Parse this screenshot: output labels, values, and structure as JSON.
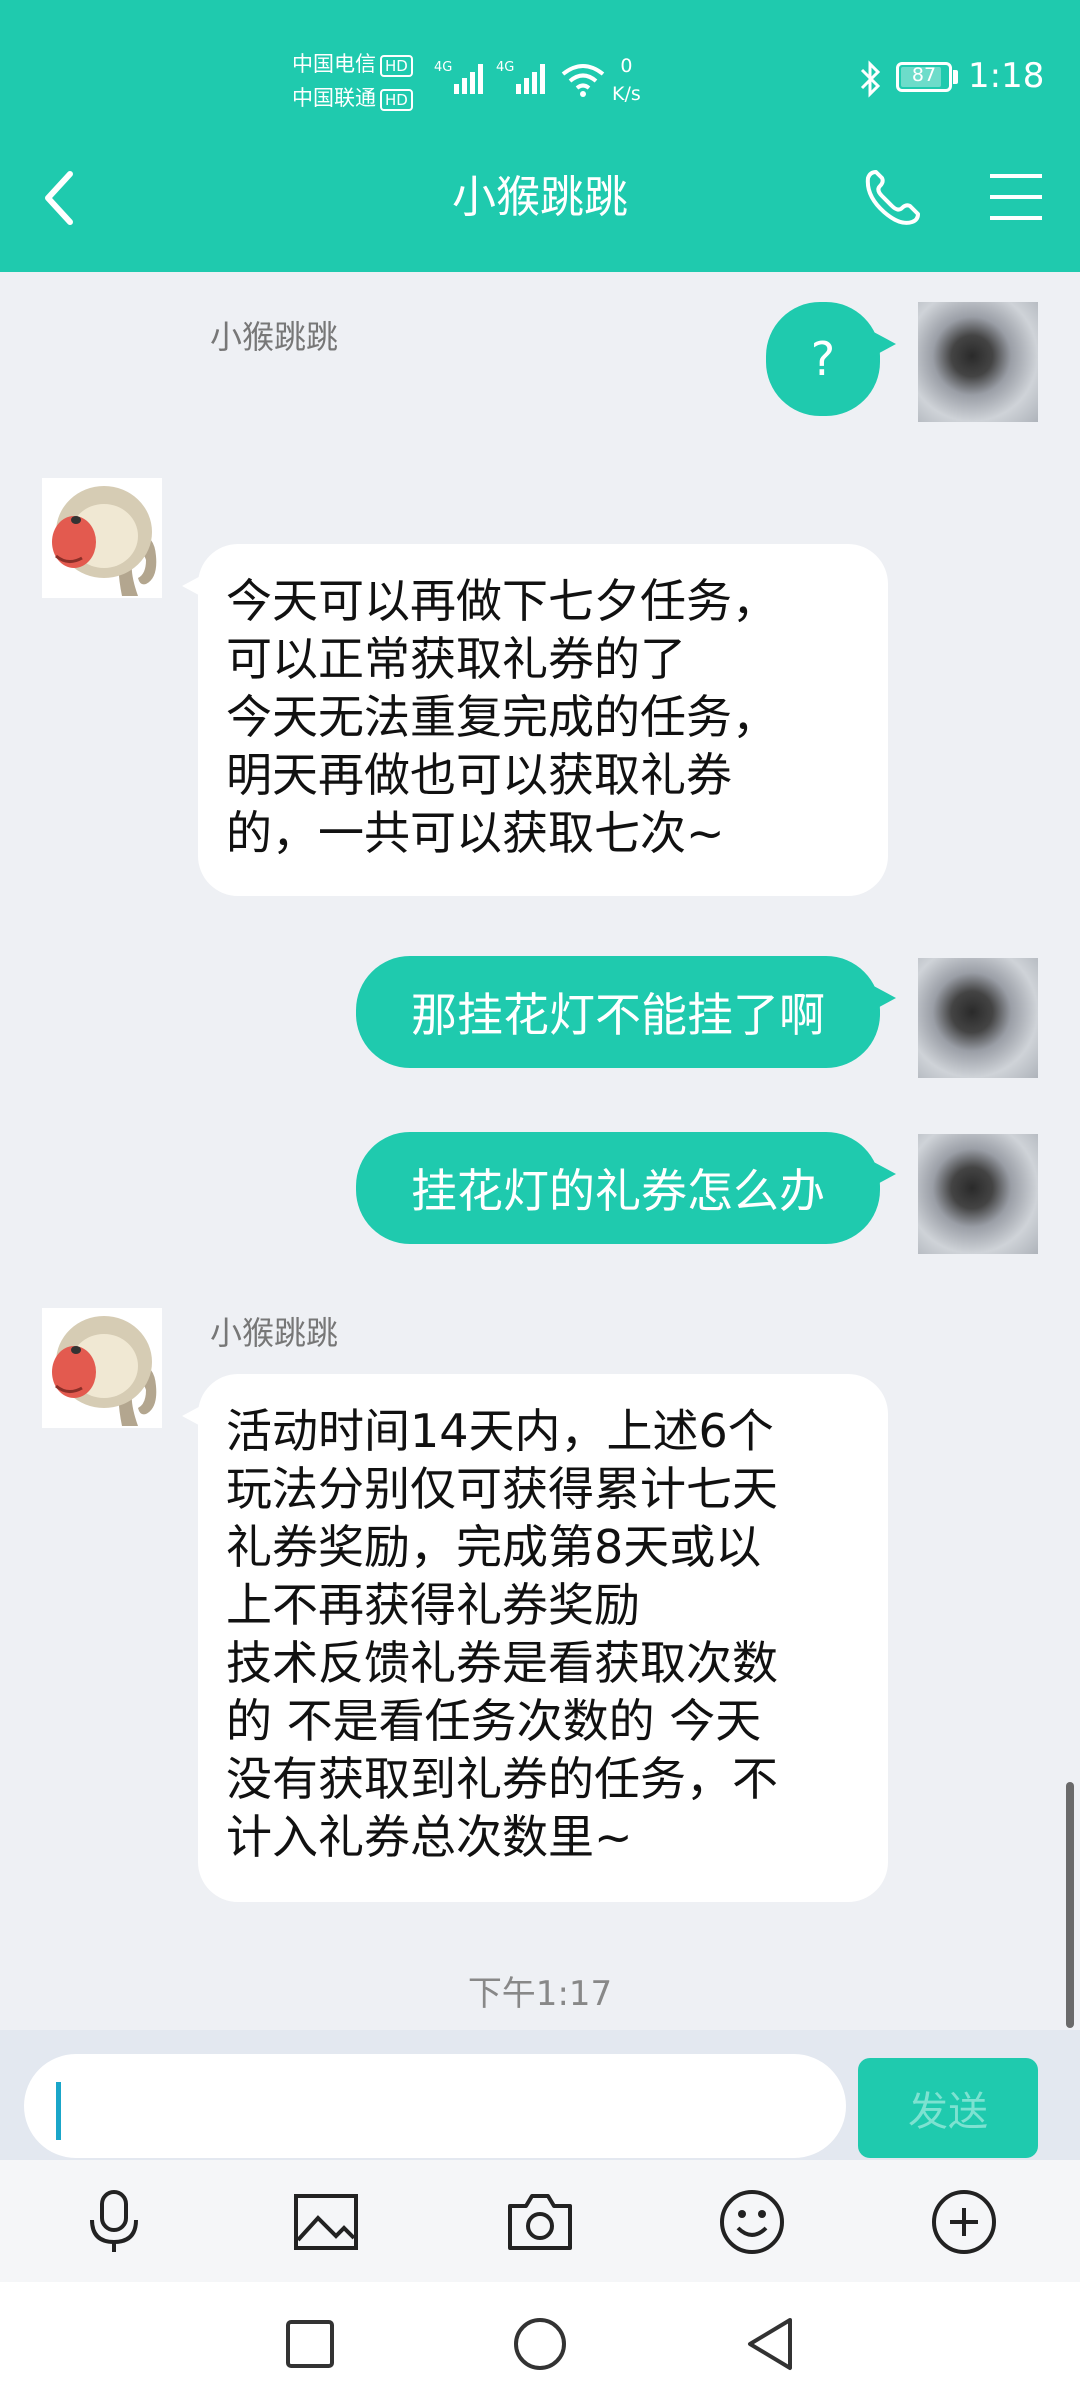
{
  "status_bar": {
    "carrier1": "中国电信",
    "carrier2": "中国联通",
    "hd": "HD",
    "net1": "4G",
    "net2": "4G",
    "speed_value": "0",
    "speed_unit": "K/s",
    "battery": "87",
    "time": "1:18"
  },
  "header": {
    "title": "小猴跳跳"
  },
  "messages": [
    {
      "type": "out",
      "text": "?"
    },
    {
      "type": "in",
      "sender": "小猴跳跳",
      "text": "今天可以再做下七夕任务，\n可以正常获取礼券的了\n今天无法重复完成的任务，\n明天再做也可以获取礼券\n的，一共可以获取七次~"
    },
    {
      "type": "out",
      "text": "那挂花灯不能挂了啊"
    },
    {
      "type": "out",
      "text": "挂花灯的礼券怎么办"
    },
    {
      "type": "in",
      "sender": "小猴跳跳",
      "text": "活动时间14天内，上述6个\n玩法分别仅可获得累计七天\n礼券奖励，完成第8天或以\n上不再获得礼券奖励\n技术反馈礼券是看获取次数\n的 不是看任务次数的 今天\n没有获取到礼券的任务，不\n计入礼券总次数里~"
    }
  ],
  "timestamp": "下午1:17",
  "input": {
    "value": "",
    "send_label": "发送"
  },
  "toolbar": [
    "mic-icon",
    "image-icon",
    "camera-icon",
    "emoji-icon",
    "plus-icon"
  ],
  "nav": [
    "recent-apps-icon",
    "home-icon",
    "back-icon"
  ],
  "colors": {
    "accent": "#1fcaae",
    "background": "#eef0f4"
  }
}
